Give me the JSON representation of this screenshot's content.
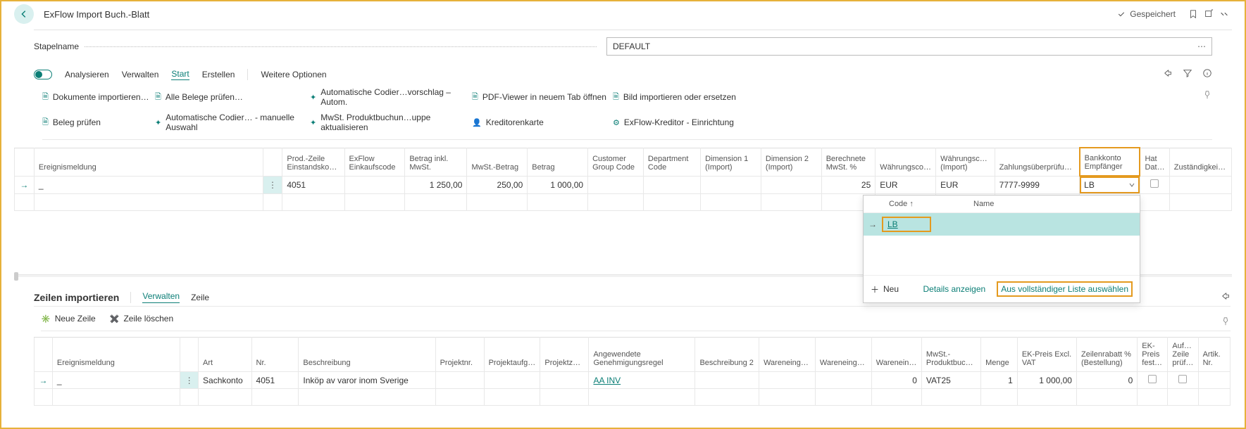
{
  "header": {
    "title": "ExFlow Import Buch.-Blatt",
    "saved": "Gespeichert"
  },
  "batch": {
    "label": "Stapelname",
    "value": "DEFAULT"
  },
  "tabs": {
    "analyse": "Analysieren",
    "verwalten": "Verwalten",
    "start": "Start",
    "erstellen": "Erstellen",
    "mehr": "Weitere Optionen"
  },
  "actions": {
    "r1a": "Dokumente importieren…",
    "r1b": "Alle Belege prüfen…",
    "r1c": "Automatische Codier…vorschlag – Autom.",
    "r1d": "PDF-Viewer in neuem Tab öffnen",
    "r1e": "Bild importieren oder ersetzen",
    "r2a": "Beleg prüfen",
    "r2b": "Automatische Codier… - manuelle Auswahl",
    "r2c": "MwSt. Produktbuchun…uppe aktualisieren",
    "r2d": "Kreditorenkarte",
    "r2e": "ExFlow-Kreditor - Einrichtung"
  },
  "grid1": {
    "cols": {
      "eventmsg": "Ereignismeldung",
      "prodzeile": "Prod.-Zeile Einstandskon…",
      "exflow": "ExFlow Einkaufscode",
      "betraginkl": "Betrag inkl. MwSt.",
      "mwstbetrag": "MwSt.-Betrag",
      "betrag": "Betrag",
      "cgroup": "Customer Group Code",
      "dept": "Department Code",
      "dim1": "Dimension 1 (Import)",
      "dim2": "Dimension 2 (Import)",
      "mwstpc": "Berechnete MwSt. %",
      "curr": "Währungscode",
      "currimp": "Währungsc… (Import)",
      "zahlprueef": "Zahlungsüberprüfungskont…",
      "bank": "Bankkonto Empfänger",
      "hat": "Hat Dat…",
      "zust": "Zuständigkei…"
    },
    "row": {
      "cursor": "_",
      "prodzeile": "4051",
      "betraginkl": "1 250,00",
      "mwstbetrag": "250,00",
      "betrag": "1 000,00",
      "mwstpc": "25",
      "curr": "EUR",
      "currimp": "EUR",
      "zahlprueef": "7777-9999",
      "bank": "LB"
    }
  },
  "dropdown": {
    "codeHead": "Code ↑",
    "nameHead": "Name",
    "val": "LB",
    "neu": "Neu",
    "details": "Details anzeigen",
    "full": "Aus vollständiger Liste auswählen"
  },
  "section2": {
    "title": "Zeilen importieren",
    "tab1": "Verwalten",
    "tab2": "Zeile",
    "neuzeile": "Neue Zeile",
    "delzeile": "Zeile löschen"
  },
  "grid2": {
    "cols": {
      "eventmsg": "Ereignismeldung",
      "art": "Art",
      "nr": "Nr.",
      "beschr": "Beschreibung",
      "projektnr": "Projektnr.",
      "projaufg": "Projektaufga…",
      "projzeil": "Projektzeil…",
      "genehm": "Angewendete Genehmigungsregel",
      "beschr2": "Beschreibung 2",
      "we1": "Wareneingan…",
      "we2": "Wareneingan…",
      "we3": "Wareneing…",
      "mwstprod": "MwSt.-Produktbuch…",
      "menge": "Menge",
      "ekpreis": "EK-Preis Excl. VAT",
      "zrabatt": "Zeilenrabatt % (Bestellung)",
      "ekfest": "EK-Preis fest…",
      "aufz": "Auf… Zeile prüf…",
      "artiknr": "Artik. Nr."
    },
    "row": {
      "cursor": "_",
      "art": "Sachkonto",
      "nr": "4051",
      "beschr": "Inköp av varor inom Sverige",
      "genehm": "AA INV",
      "we3": "0",
      "mwstprod": "VAT25",
      "menge": "1",
      "ekpreis": "1 000,00",
      "zrabatt": "0"
    }
  }
}
